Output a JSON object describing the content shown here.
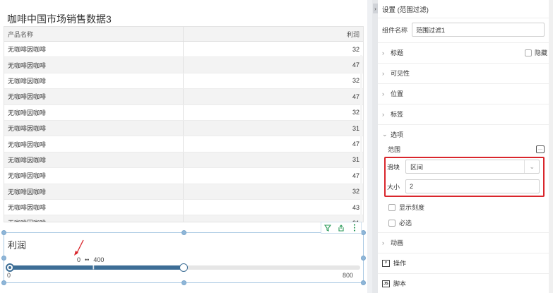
{
  "table": {
    "title": "咖啡中国市场销售数据3",
    "columns": [
      "产品名称",
      "利润"
    ],
    "rows": [
      [
        "无咖啡因咖啡",
        "32"
      ],
      [
        "无咖啡因咖啡",
        "47"
      ],
      [
        "无咖啡因咖啡",
        "32"
      ],
      [
        "无咖啡因咖啡",
        "47"
      ],
      [
        "无咖啡因咖啡",
        "32"
      ],
      [
        "无咖啡因咖啡",
        "31"
      ],
      [
        "无咖啡因咖啡",
        "47"
      ],
      [
        "无咖啡因咖啡",
        "31"
      ],
      [
        "无咖啡因咖啡",
        "47"
      ],
      [
        "无咖啡因咖啡",
        "32"
      ],
      [
        "无咖啡因咖啡",
        "43"
      ],
      [
        "无咖啡因咖啡",
        "31"
      ]
    ]
  },
  "filter_widget": {
    "title": "利润",
    "range_start": "0",
    "range_sep": "••",
    "range_end": "400",
    "axis_min": "0",
    "axis_max": "800",
    "selected_fraction": 0.5,
    "toolbar_icons": [
      "filter-icon",
      "export-icon",
      "more-icon"
    ]
  },
  "panel": {
    "header": "设置 (范围过滤)",
    "name_label": "组件名称",
    "name_value": "范围过滤1",
    "sections": {
      "title": "标题",
      "visibility": "可见性",
      "position": "位置",
      "tags": "标签",
      "options": "选项",
      "animation": "动画",
      "actions": "操作",
      "script": "脚本"
    },
    "hide_label": "隐藏",
    "range_label": "范围",
    "slider_label": "滑块",
    "slider_value": "区间",
    "size_label": "大小",
    "size_value": "2",
    "show_ticks_label": "显示刻度",
    "required_label": "必选",
    "script_icon_text": "JS"
  },
  "colors": {
    "accent": "#3d6e96",
    "highlight": "#d9262c",
    "arrow": "#d9262c",
    "selection_border": "#a8c8e3"
  }
}
